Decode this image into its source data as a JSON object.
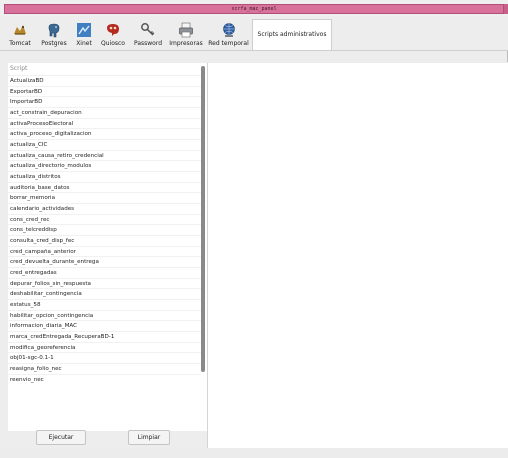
{
  "window": {
    "title": "scrfa_mac_panel"
  },
  "toolbar": {
    "items": [
      {
        "label": "Tomcat",
        "icon": "tomcat-icon"
      },
      {
        "label": "Postgres",
        "icon": "postgres-elephant-icon"
      },
      {
        "label": "Xinet",
        "icon": "xinet-icon"
      },
      {
        "label": "Quiosco",
        "icon": "quiosco-icon"
      },
      {
        "label": "Password",
        "icon": "key-icon"
      },
      {
        "label": "Impresoras",
        "icon": "printer-icon"
      },
      {
        "label": "Red temporal",
        "icon": "network-icon"
      },
      {
        "label": "Scripts administrativos",
        "icon": "",
        "active": true
      }
    ]
  },
  "scripts": {
    "header": "Script",
    "items": [
      "ActualizaBD",
      "ExportarBD",
      "ImportarBD",
      "act_constrain_depuracion",
      "activaProcesoElectoral",
      "activa_proceso_digitalizacion",
      "actualiza_CIC",
      "actualiza_causa_retiro_credencial",
      "actualiza_directorio_modulos",
      "actualiza_distritos",
      "auditoria_base_datos",
      "borrar_memoria",
      "calendario_actividades",
      "cons_cred_rec",
      "cons_telcreddisp",
      "consulta_cred_disp_fec",
      "cred_campaña_anterior",
      "cred_devuelta_durante_entrega",
      "cred_entregadas",
      "depurar_folios_sin_respuesta",
      "deshabilitar_contingencia",
      "estatus_58",
      "habilitar_opcion_contingencia",
      "informacion_diaria_MAC",
      "marca_credEntregada_RecuperaBD-1",
      "modifica_georeferencia",
      "obj01-sgc-0.1-1",
      "reasigna_folio_nec",
      "reenvio_nec"
    ]
  },
  "buttons": {
    "run": "Ejecutar",
    "clear": "Limpiar"
  },
  "colors": {
    "titlebar": "#d9729b",
    "selected_tab": "#ffffff"
  }
}
